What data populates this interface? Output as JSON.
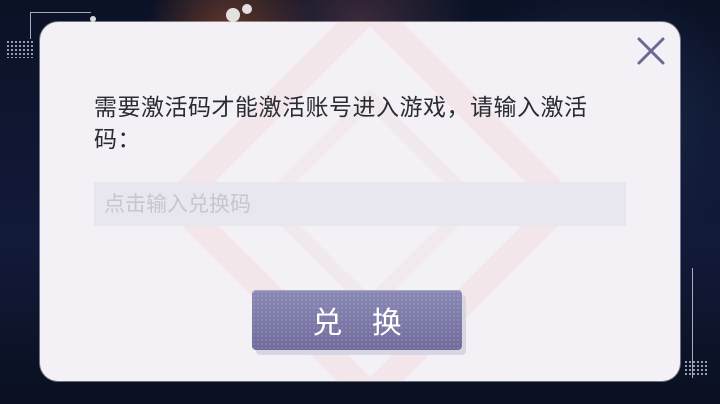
{
  "dialog": {
    "message": "需要激活码才能激活账号进入游戏，请输入激活码：",
    "input": {
      "placeholder": "点击输入兑换码",
      "value": ""
    },
    "redeem_label": "兑 换",
    "close_icon": "close-icon"
  },
  "colors": {
    "dialog_background": "#f3f1f6",
    "button_background": "#7b78a8",
    "close_icon": "#6b6896",
    "input_background": "#e8e6ee"
  }
}
